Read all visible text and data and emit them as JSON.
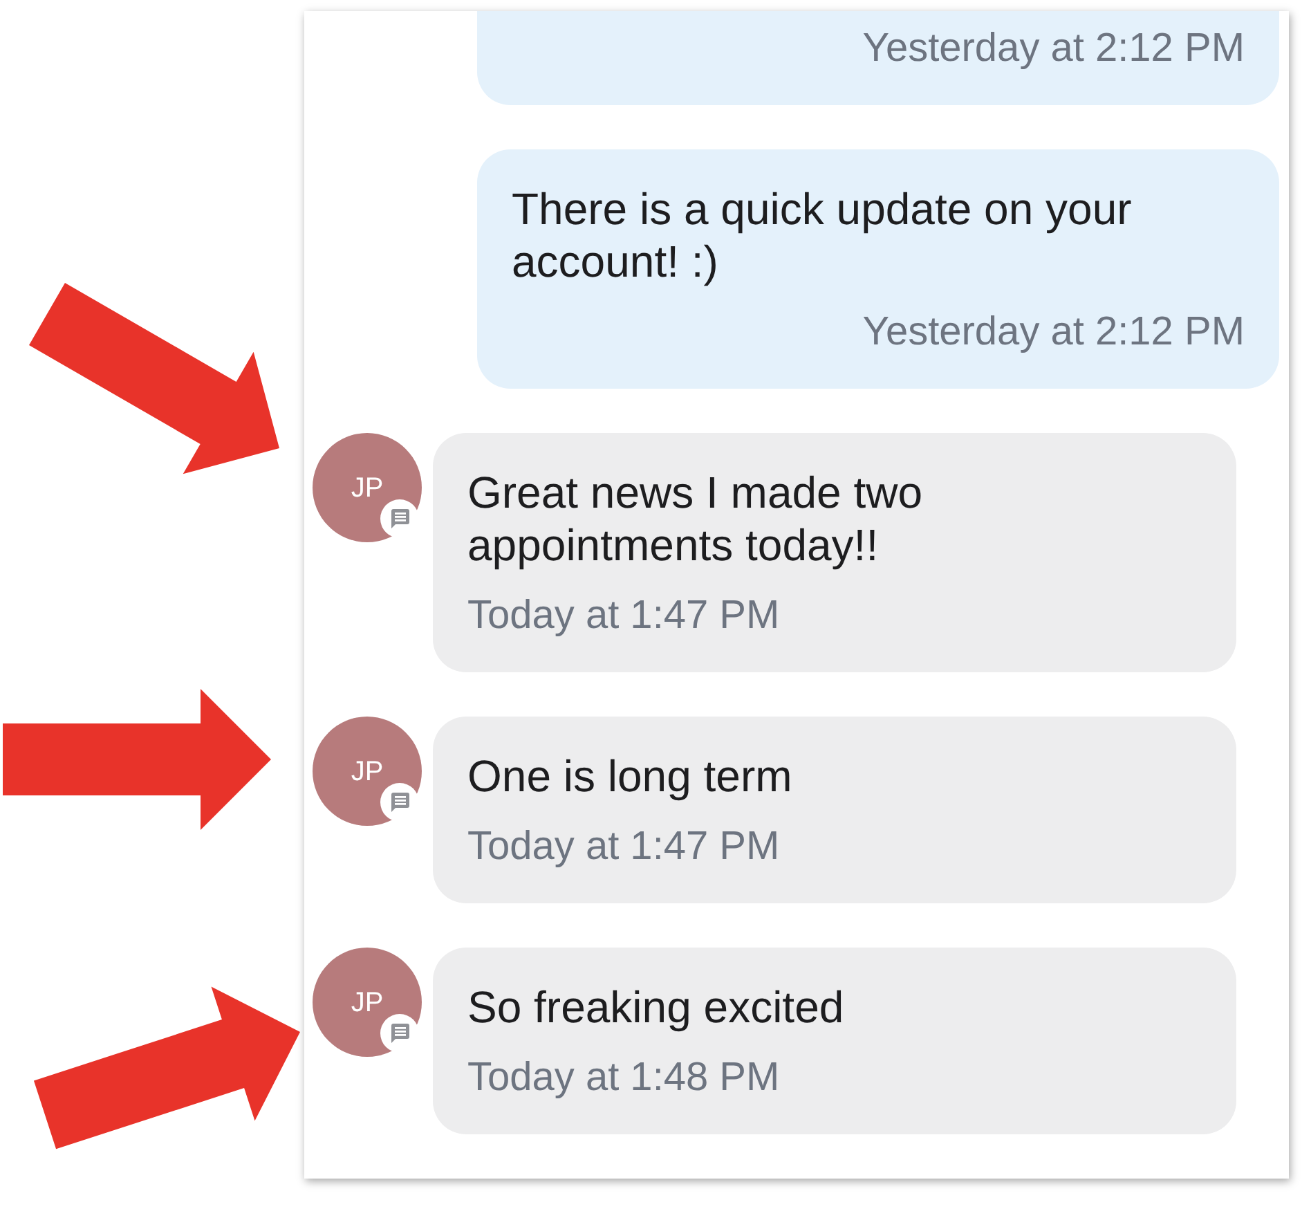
{
  "messages": [
    {
      "kind": "outgoing",
      "timestamp": "Yesterday at 2:12 PM"
    },
    {
      "kind": "outgoing",
      "text": "There is a quick update on your account! :)",
      "timestamp": "Yesterday at 2:12 PM"
    },
    {
      "kind": "incoming",
      "avatar": {
        "initials": "JP"
      },
      "text": "Great news I made two appointments today!!",
      "timestamp": "Today at 1:47 PM",
      "annotated": true
    },
    {
      "kind": "incoming",
      "avatar": {
        "initials": "JP"
      },
      "text": "One is long term",
      "timestamp": "Today at 1:47 PM",
      "annotated": true
    },
    {
      "kind": "incoming",
      "avatar": {
        "initials": "JP"
      },
      "text": "So freaking excited",
      "timestamp": "Today at 1:48 PM",
      "annotated": true
    }
  ]
}
